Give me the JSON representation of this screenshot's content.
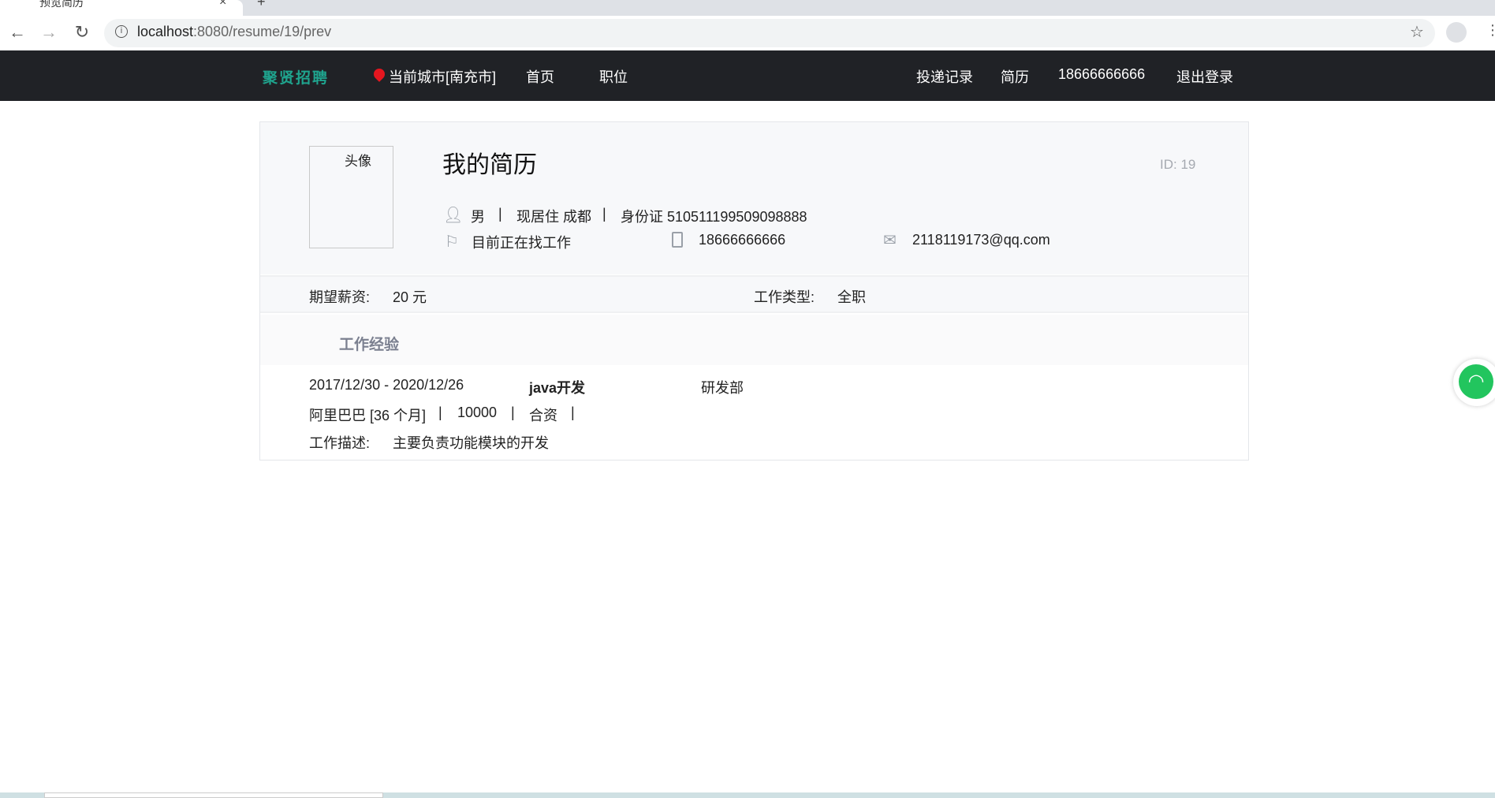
{
  "browser": {
    "tab_title": "预览简历",
    "url_host": "localhost",
    "url_path": ":8080/resume/19/prev"
  },
  "nav": {
    "logo": "聚贤招聘",
    "city": "当前城市[南充市]",
    "home": "首页",
    "jobs": "职位",
    "applications": "投递记录",
    "resume": "简历",
    "phone": "18666666666",
    "logout": "退出登录"
  },
  "resume": {
    "photo_alt": "头像",
    "title": "我的简历",
    "id": "ID: 19",
    "gender": "男",
    "residence": "现居住 成都",
    "id_card": "身份证 510511199509098888",
    "sep": "|",
    "status": "目前正在找工作",
    "mobile": "18666666666",
    "email": "2118119173@qq.com",
    "salary_label": "期望薪资:",
    "salary": "20 元",
    "type_label": "工作类型:",
    "type": "全职",
    "work_header": "工作经验",
    "work": {
      "period": "2017/12/30 - 2020/12/26",
      "position": "java开发",
      "department": "研发部",
      "company": "阿里巴巴 [36 个月]",
      "salary": "10000",
      "nature": "合资",
      "desc_label": "工作描述:",
      "desc": "主要负责功能模块的开发"
    }
  }
}
